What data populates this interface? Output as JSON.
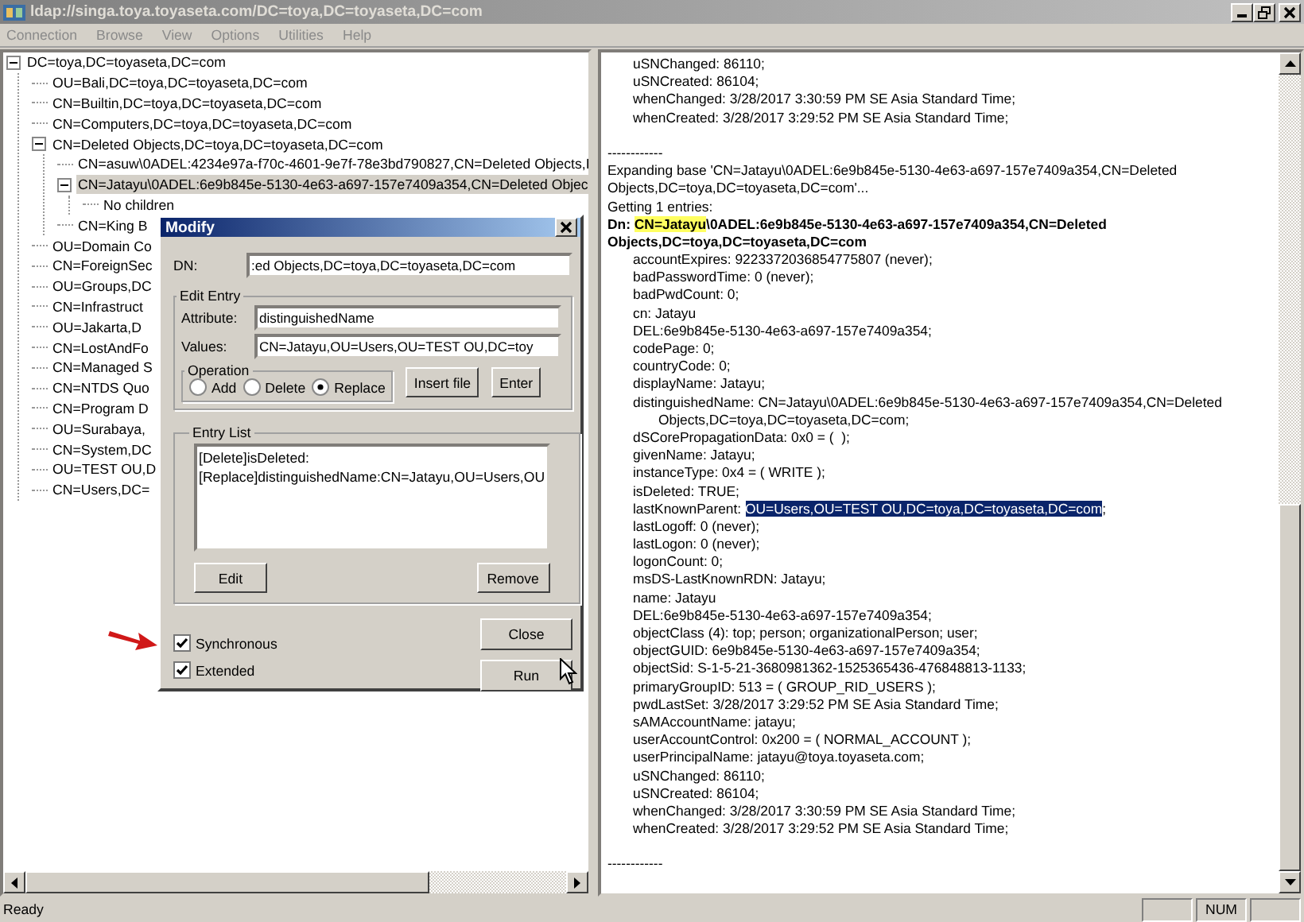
{
  "window": {
    "title": "ldap://singa.toya.toyaseta.com/DC=toya,DC=toyaseta,DC=com",
    "active": false
  },
  "menu": [
    "Connection",
    "Browse",
    "View",
    "Options",
    "Utilities",
    "Help"
  ],
  "tree": {
    "label": "DC=toya,DC=toyaseta,DC=com",
    "expanded": true,
    "selected": false,
    "children": [
      {
        "label": "OU=Bali,DC=toya,DC=toyaseta,DC=com",
        "selected": false
      },
      {
        "label": "CN=Builtin,DC=toya,DC=toyaseta,DC=com",
        "selected": false
      },
      {
        "label": "CN=Computers,DC=toya,DC=toyaseta,DC=com",
        "selected": false
      },
      {
        "label": "CN=Deleted Objects,DC=toya,DC=toyaseta,DC=com",
        "expanded": true,
        "selected": false,
        "children": [
          {
            "label": "CN=asuw\\0ADEL:4234e97a-f70c-4601-9e7f-78e3bd790827,CN=Deleted Objects,I",
            "selected": false
          },
          {
            "label": "CN=Jatayu\\0ADEL:6e9b845e-5130-4e63-a697-157e7409a354,CN=Deleted Objec",
            "expanded": true,
            "selected": true,
            "children": [
              {
                "label": "No children",
                "selected": false
              }
            ]
          },
          {
            "label": "CN=King B",
            "selected": false
          }
        ]
      },
      {
        "label": "OU=Domain Co",
        "selected": false
      },
      {
        "label": "CN=ForeignSec",
        "selected": false
      },
      {
        "label": "OU=Groups,DC",
        "selected": false
      },
      {
        "label": "CN=Infrastruct",
        "selected": false
      },
      {
        "label": "OU=Jakarta,D",
        "selected": false
      },
      {
        "label": "CN=LostAndFo",
        "selected": false
      },
      {
        "label": "CN=Managed S",
        "selected": false
      },
      {
        "label": "CN=NTDS Quo",
        "selected": false
      },
      {
        "label": "CN=Program D",
        "selected": false
      },
      {
        "label": "OU=Surabaya,",
        "selected": false
      },
      {
        "label": "CN=System,DC",
        "selected": false
      },
      {
        "label": "OU=TEST OU,D",
        "selected": false
      },
      {
        "label": "CN=Users,DC=",
        "selected": false
      }
    ]
  },
  "output": [
    {
      "kind": "attr",
      "text": "uSNChanged: 86110;"
    },
    {
      "kind": "attr",
      "text": "uSNCreated: 86104;"
    },
    {
      "kind": "attr",
      "text": "whenChanged: 3/28/2017 3:30:59 PM SE Asia Standard Time;"
    },
    {
      "kind": "attr",
      "text": "whenCreated: 3/28/2017 3:29:52 PM SE Asia Standard Time;"
    },
    {
      "kind": "blank"
    },
    {
      "kind": "separator",
      "text": "------------"
    },
    {
      "kind": "plain",
      "text": "Expanding base 'CN=Jatayu\\0ADEL:6e9b845e-5130-4e63-a697-157e7409a354,CN=Deleted"
    },
    {
      "kind": "plain",
      "text": "Objects,DC=toya,DC=toyaseta,DC=com'..."
    },
    {
      "kind": "plain",
      "text": "Getting 1 entries:"
    },
    {
      "kind": "dn",
      "label": "Dn: ",
      "highlight": "CN=Jatayu",
      "text": "\\0ADEL:6e9b845e-5130-4e63-a697-157e7409a354,CN=Deleted"
    },
    {
      "kind": "dn",
      "text": "Objects,DC=toya,DC=toyaseta,DC=com"
    },
    {
      "kind": "attr",
      "text": "accountExpires: 9223372036854775807 (never);"
    },
    {
      "kind": "attr",
      "text": "badPasswordTime: 0 (never);"
    },
    {
      "kind": "attr",
      "text": "badPwdCount: 0;"
    },
    {
      "kind": "attr",
      "text": "cn: Jatayu"
    },
    {
      "kind": "attr",
      "text": "DEL:6e9b845e-5130-4e63-a697-157e7409a354;"
    },
    {
      "kind": "attr",
      "text": "codePage: 0;"
    },
    {
      "kind": "attr",
      "text": "countryCode: 0;"
    },
    {
      "kind": "attr",
      "text": "displayName: Jatayu;"
    },
    {
      "kind": "attr",
      "text": "distinguishedName: CN=Jatayu\\0ADEL:6e9b845e-5130-4e63-a697-157e7409a354,CN=Deleted"
    },
    {
      "kind": "continuation",
      "text": "Objects,DC=toya,DC=toyaseta,DC=com;"
    },
    {
      "kind": "attr",
      "text": "dSCorePropagationData: 0x0 = (  );"
    },
    {
      "kind": "attr",
      "text": "givenName: Jatayu;"
    },
    {
      "kind": "attr",
      "text": "instanceType: 0x4 = ( WRITE );"
    },
    {
      "kind": "attr",
      "text": "isDeleted: TRUE;"
    },
    {
      "kind": "attr",
      "text": "lastKnownParent: ",
      "selection": "OU=Users,OU=TEST OU,DC=toya,DC=toyaseta,DC=com",
      "after": ";"
    },
    {
      "kind": "attr",
      "text": "lastLogoff: 0 (never);"
    },
    {
      "kind": "attr",
      "text": "lastLogon: 0 (never);"
    },
    {
      "kind": "attr",
      "text": "logonCount: 0;"
    },
    {
      "kind": "attr",
      "text": "msDS-LastKnownRDN: Jatayu;"
    },
    {
      "kind": "attr",
      "text": "name: Jatayu"
    },
    {
      "kind": "attr",
      "text": "DEL:6e9b845e-5130-4e63-a697-157e7409a354;"
    },
    {
      "kind": "attr",
      "text": "objectClass (4): top; person; organizationalPerson; user;"
    },
    {
      "kind": "attr",
      "text": "objectGUID: 6e9b845e-5130-4e63-a697-157e7409a354;"
    },
    {
      "kind": "attr",
      "text": "objectSid: S-1-5-21-3680981362-1525365436-476848813-1133;"
    },
    {
      "kind": "attr",
      "text": "primaryGroupID: 513 = ( GROUP_RID_USERS );"
    },
    {
      "kind": "attr",
      "text": "pwdLastSet: 3/28/2017 3:29:52 PM SE Asia Standard Time;"
    },
    {
      "kind": "attr",
      "text": "sAMAccountName: jatayu;"
    },
    {
      "kind": "attr",
      "text": "userAccountControl: 0x200 = ( NORMAL_ACCOUNT );"
    },
    {
      "kind": "attr",
      "text": "userPrincipalName: jatayu@toya.toyaseta.com;"
    },
    {
      "kind": "attr",
      "text": "uSNChanged: 86110;"
    },
    {
      "kind": "attr",
      "text": "uSNCreated: 86104;"
    },
    {
      "kind": "attr",
      "text": "whenChanged: 3/28/2017 3:30:59 PM SE Asia Standard Time;"
    },
    {
      "kind": "attr",
      "text": "whenCreated: 3/28/2017 3:29:52 PM SE Asia Standard Time;"
    },
    {
      "kind": "blank"
    },
    {
      "kind": "separator",
      "text": "------------"
    }
  ],
  "dialog": {
    "title": "Modify",
    "dn": {
      "label": "DN:",
      "value": ":ed Objects,DC=toya,DC=toyaseta,DC=com"
    },
    "edit_entry": {
      "title": "Edit Entry",
      "attribute": {
        "label": "Attribute:",
        "value": "distinguishedName"
      },
      "values": {
        "label": "Values:",
        "value": "CN=Jatayu,OU=Users,OU=TEST OU,DC=toy"
      },
      "operation": {
        "title": "Operation",
        "options": [
          {
            "label": "Add",
            "selected": false
          },
          {
            "label": "Delete",
            "selected": false
          },
          {
            "label": "Replace",
            "selected": true
          }
        ]
      },
      "buttons": [
        "Insert file",
        "Enter"
      ]
    },
    "entry_list": {
      "title": "Entry List",
      "items": [
        "[Delete]isDeleted:",
        "[Replace]distinguishedName:CN=Jatayu,OU=Users,OU"
      ],
      "buttons": [
        "Edit",
        "Remove"
      ]
    },
    "options": [
      {
        "label": "Synchronous",
        "checked": true
      },
      {
        "label": "Extended",
        "checked": true
      }
    ],
    "buttons": [
      "Close",
      "Run"
    ]
  },
  "status_bar": {
    "text": "Ready",
    "panels": [
      "NUM"
    ]
  }
}
